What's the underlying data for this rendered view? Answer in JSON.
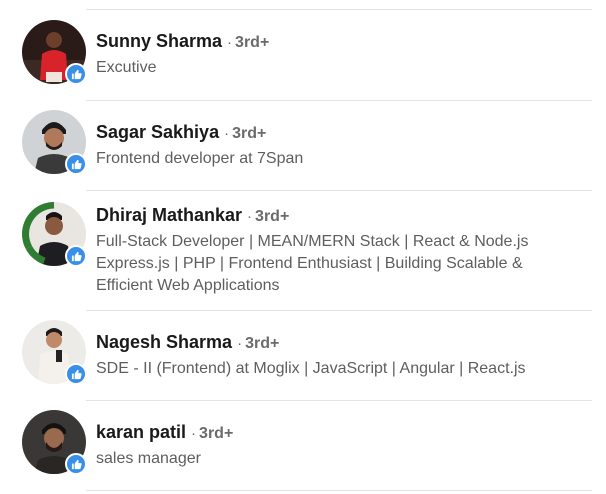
{
  "people": [
    {
      "name": "Sunny Sharma",
      "separator": "·",
      "degree": "3rd+",
      "headline_lines": [
        "Excutive"
      ],
      "reaction_icon": "like-icon",
      "accent": "#378fe9"
    },
    {
      "name": "Sagar Sakhiya",
      "separator": "·",
      "degree": "3rd+",
      "headline_lines": [
        "Frontend developer at 7Span"
      ],
      "reaction_icon": "like-icon",
      "accent": "#378fe9"
    },
    {
      "name": "Dhiraj Mathankar",
      "separator": "·",
      "degree": "3rd+",
      "headline_lines": [
        "Full-Stack Developer | MEAN/MERN Stack | React & Node.js",
        "Express.js | PHP | Frontend Enthusiast | Building Scalable &",
        "Efficient Web Applications"
      ],
      "avatar_frame_text": "#OPENTOWORK",
      "reaction_icon": "like-icon",
      "accent": "#378fe9"
    },
    {
      "name": "Nagesh Sharma",
      "separator": "·",
      "degree": "3rd+",
      "headline_lines": [
        "SDE - II (Frontend) at Moglix | JavaScript | Angular | React.js"
      ],
      "reaction_icon": "like-icon",
      "accent": "#378fe9"
    },
    {
      "name": "karan patil",
      "separator": "·",
      "degree": "3rd+",
      "headline_lines": [
        "sales manager"
      ],
      "reaction_icon": "like-icon",
      "accent": "#378fe9"
    }
  ]
}
